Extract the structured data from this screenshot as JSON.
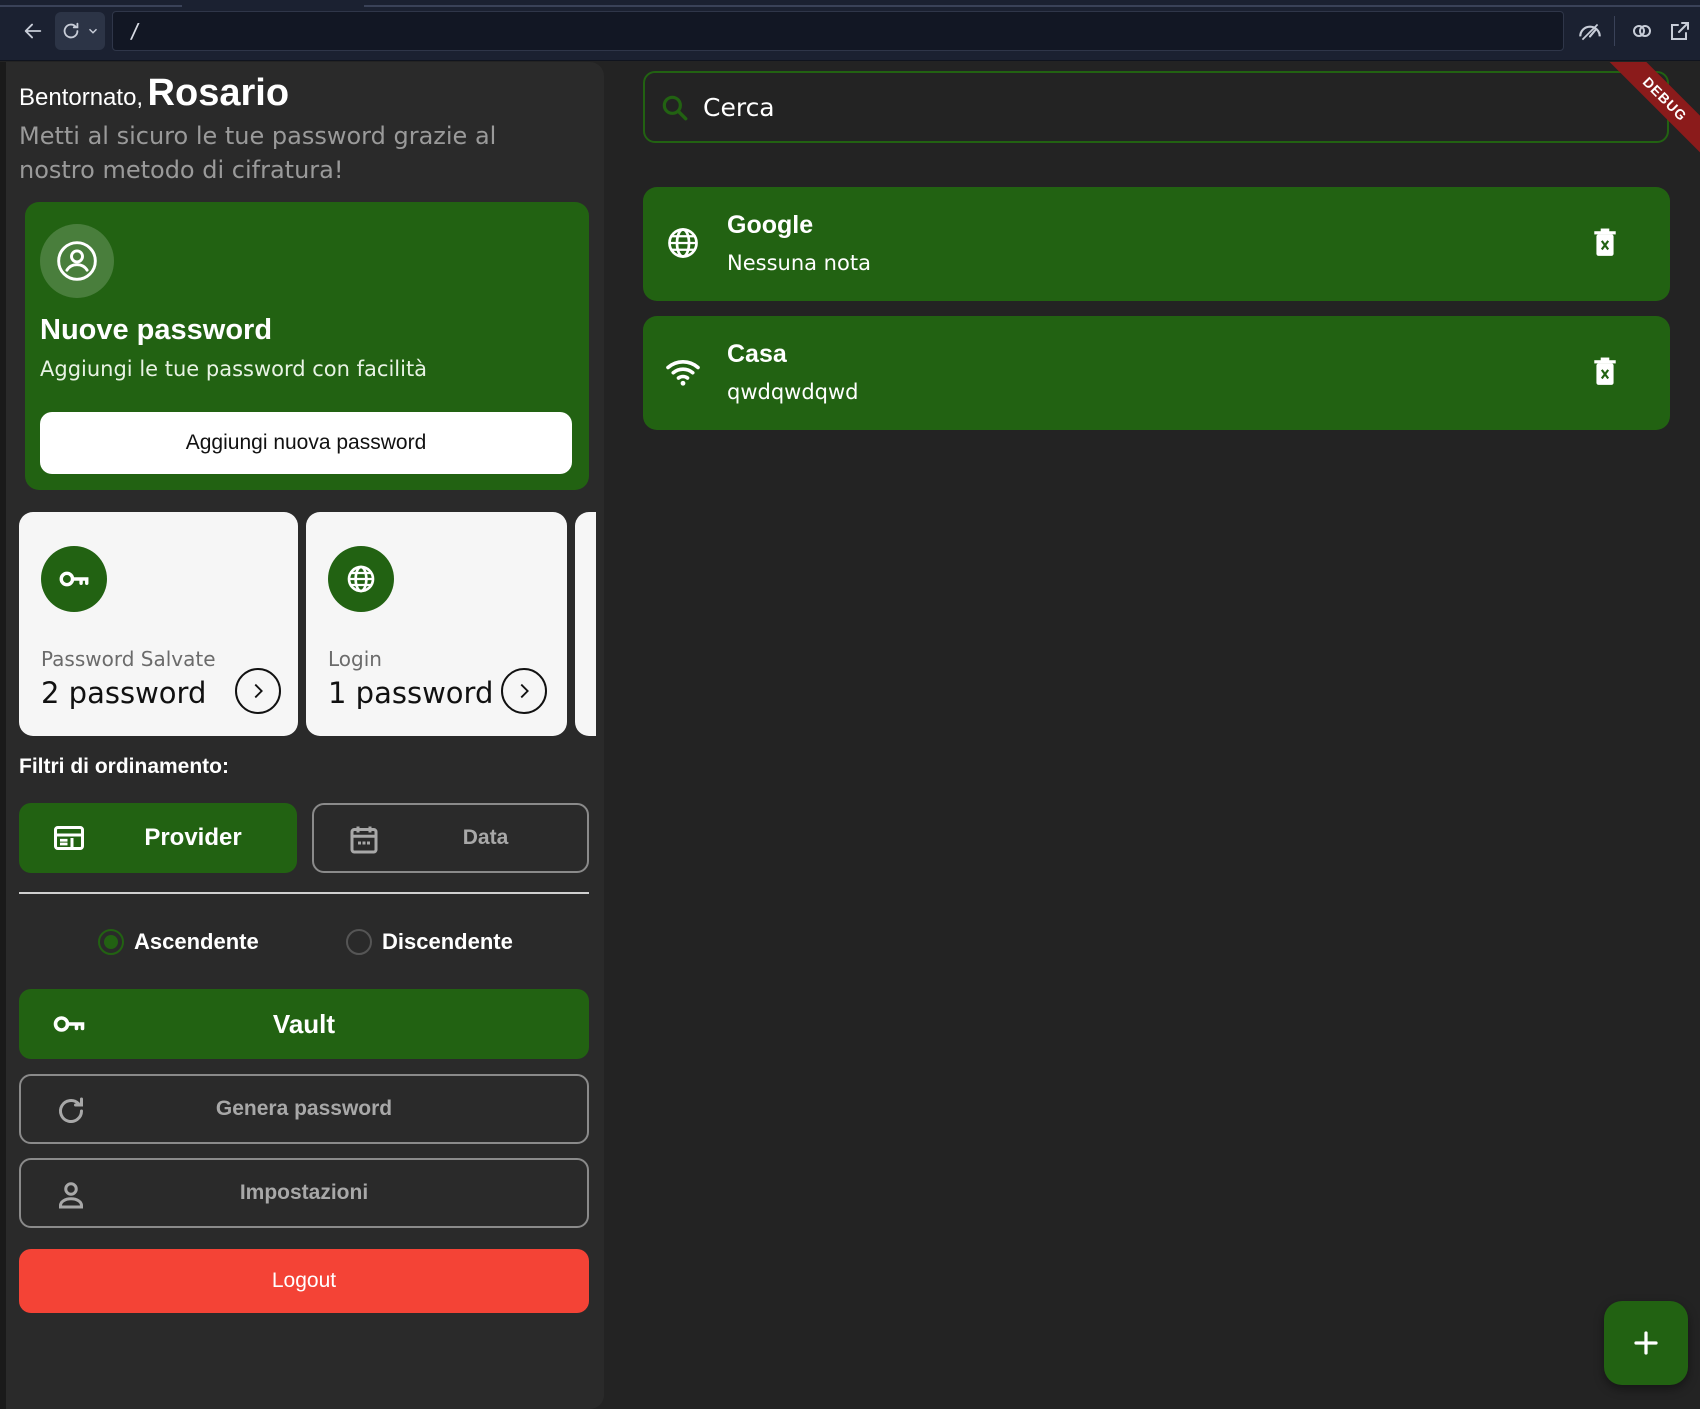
{
  "browser": {
    "url": "/"
  },
  "greeting": {
    "hello": "Bentornato,",
    "name": "Rosario",
    "subtitle": "Metti al sicuro le tue password grazie al nostro metodo di cifratura!"
  },
  "new_password_card": {
    "title": "Nuove password",
    "description": "Aggiungi le tue password con facilità",
    "button_label": "Aggiungi nuova password"
  },
  "stats": [
    {
      "label": "Password Salvate",
      "value": "2 password",
      "icon": "key-icon"
    },
    {
      "label": "Login",
      "value": "1 password",
      "icon": "globe-icon"
    }
  ],
  "filters": {
    "label": "Filtri di ordinamento:",
    "options": [
      {
        "label": "Provider",
        "icon": "card-icon",
        "selected": true
      },
      {
        "label": "Data",
        "icon": "calendar-icon",
        "selected": false
      }
    ],
    "order": [
      {
        "label": "Ascendente",
        "selected": true
      },
      {
        "label": "Discendente",
        "selected": false
      }
    ]
  },
  "nav": {
    "vault": "Vault",
    "generate": "Genera password",
    "settings": "Impostazioni",
    "logout": "Logout"
  },
  "search": {
    "placeholder": "Cerca"
  },
  "items": [
    {
      "name": "Google",
      "note": "Nessuna nota",
      "icon": "globe-icon"
    },
    {
      "name": "Casa",
      "note": "qwdqwdqwd",
      "icon": "wifi-icon"
    }
  ],
  "debug_banner": "DEBUG",
  "colors": {
    "primary_green": "#226212",
    "logout_red": "#f44336",
    "background": "#232323",
    "sidebar": "#2a2a2a"
  }
}
